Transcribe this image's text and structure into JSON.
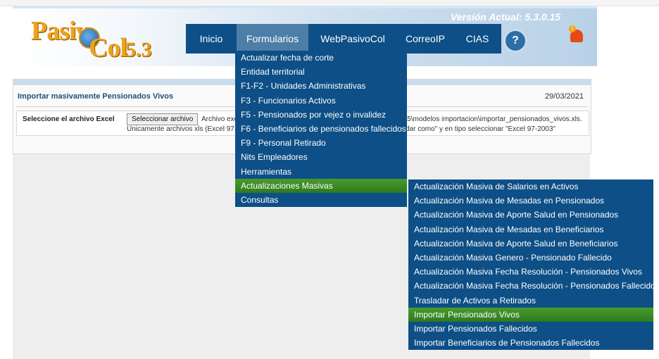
{
  "header": {
    "logo_pasiv": "Pasiv",
    "logo_col": "Col",
    "logo_version": "5.3",
    "version_label": "Versión Actual: 5.3.0.15",
    "notifications_count": "1"
  },
  "nav": {
    "items": [
      "Inicio",
      "Formularios",
      "WebPasivoCol",
      "CorreoIP",
      "CIAS"
    ],
    "help_label": "?"
  },
  "formularios_menu": [
    "Actualizar fecha de corte",
    "Entidad territorial",
    "F1-F2 - Unidades Administrativas",
    "F3 - Funcionarios Activos",
    "F5 - Pensionados por vejez o invalidez",
    "F6 - Beneficiarios de pensionados fallecidos",
    "F9 - Personal Retirado",
    "Nits Empleadores",
    "Herramientas",
    "Actualizaciones Masivas",
    "Consultas"
  ],
  "actualizaciones_submenu": [
    "Actualización Masiva de Salarios en Activos",
    "Actualización Masiva de Mesadas en Pensionados",
    "Actualización Masiva de Aporte Salud en Pensionados",
    "Actualización Masiva de Mesadas en Beneficiarios",
    "Actualización Masiva de Aporte Salud en Beneficiarios",
    "Actualización Masiva Genero - Pensionado Fallecido",
    "Actualización Masiva Fecha Resolución - Pensionados Vivos",
    "Actualización Masiva Fecha Resolución - Pensionados Fallecidos",
    "Trasladar de Activos a Retirados",
    "Importar Pensionados Vivos",
    "Importar Pensionados Fallecidos",
    "Importar Beneficiarios de Pensionados Fallecidos"
  ],
  "page": {
    "title": "Importar masivamente Pensionados Vivos",
    "date": "29/03/2021",
    "file_label": "Seleccione el archivo Excel",
    "file_button": "Seleccionar archivo",
    "hint_line1_start": "Archivo exc",
    "hint_line1_end": "l5\\modelos importacion\\importar_pensionados_vivos.xls.",
    "hint_line2_start": "Únicamente archivos xls (Excel 97-2",
    "hint_line2_end": "dar como\" y en tipo seleccionar \"Excel 97-2003\""
  }
}
